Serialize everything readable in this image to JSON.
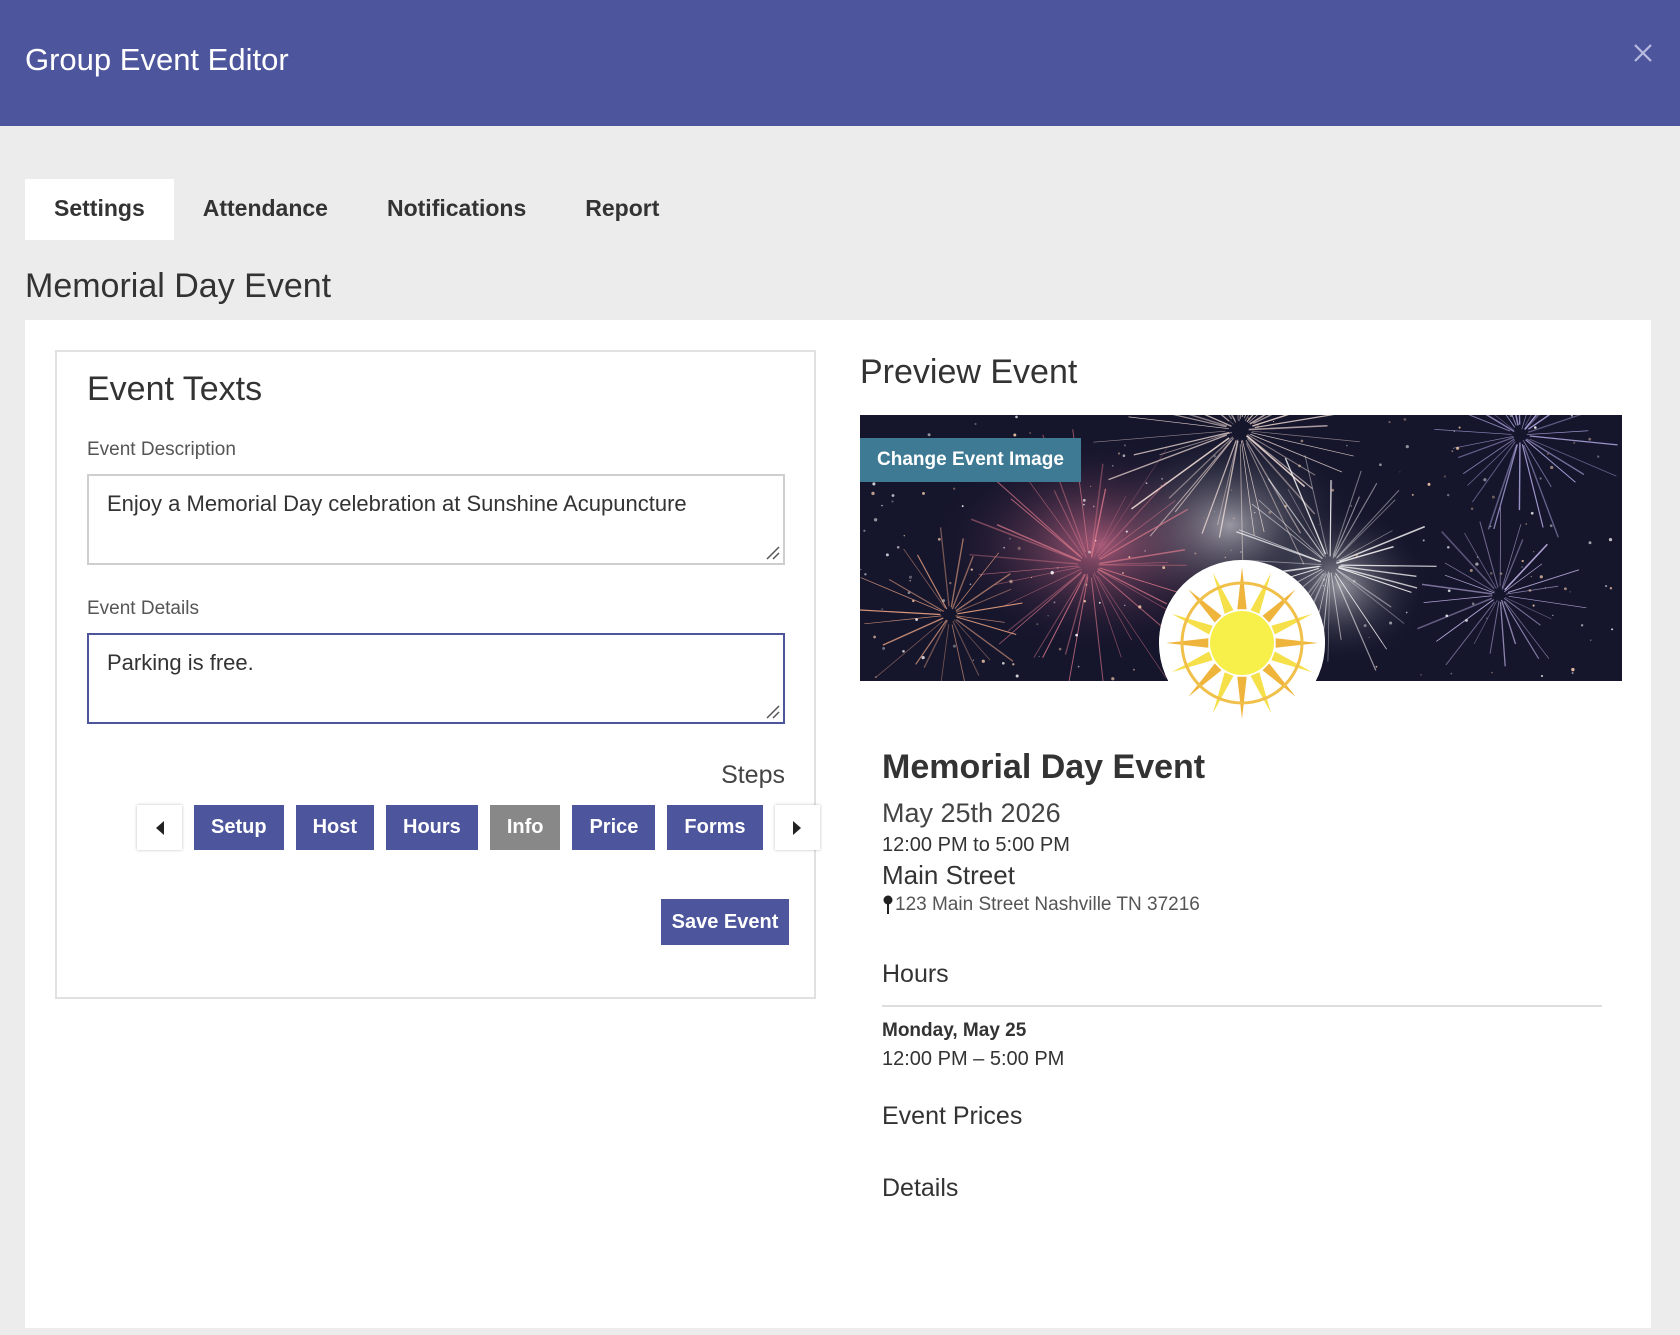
{
  "header": {
    "title": "Group Event Editor"
  },
  "tabs": [
    {
      "label": "Settings",
      "active": true
    },
    {
      "label": "Attendance"
    },
    {
      "label": "Notifications"
    },
    {
      "label": "Report"
    }
  ],
  "page_title": "Memorial Day Event",
  "event_texts": {
    "title": "Event Texts",
    "description_label": "Event Description",
    "description_value": "Enjoy a Memorial Day celebration at Sunshine Acupuncture",
    "details_label": "Event Details",
    "details_value": "Parking is free."
  },
  "steps": {
    "label": "Steps",
    "items": [
      "Setup",
      "Host",
      "Hours",
      "Info",
      "Price",
      "Forms"
    ],
    "current": "Info"
  },
  "save_label": "Save Event",
  "preview": {
    "title": "Preview Event",
    "change_image_label": "Change Event Image",
    "event_name": "Memorial Day Event",
    "date": "May 25th 2026",
    "time_range": "12:00 PM to 5:00 PM",
    "venue": "Main Street",
    "address": "123 Main Street Nashville TN 37216",
    "hours_heading": "Hours",
    "hours": [
      {
        "day": "Monday, May 25",
        "time": "12:00 PM – 5:00 PM"
      }
    ],
    "prices_heading": "Event Prices",
    "details_heading": "Details"
  },
  "colors": {
    "primary": "#4d559c",
    "step_current": "#888888",
    "change_image_button": "#3e7a94",
    "logo_sun": "#f5d94a"
  },
  "icons": [
    "close-icon",
    "chevron-left-icon",
    "chevron-right-icon",
    "map-pin-icon",
    "resize-grip-icon"
  ]
}
